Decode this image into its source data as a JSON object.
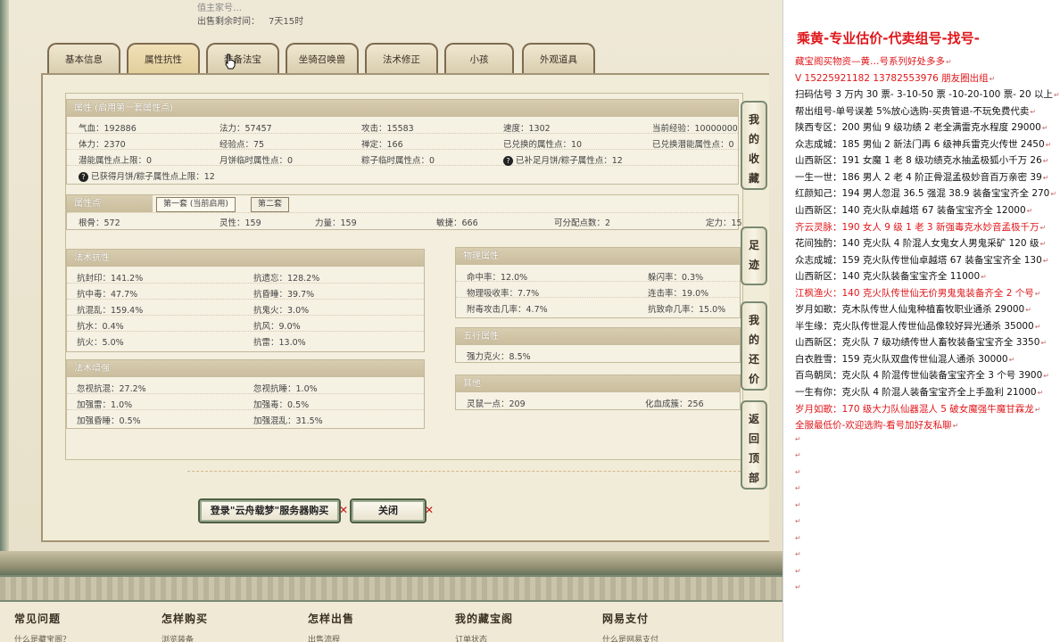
{
  "game": {
    "hidden_label": "值主家号…",
    "time_label": "出售剩余时间：",
    "time_value": "7天15时",
    "tabs": [
      "基本信息",
      "属性抗性",
      "装备法宝",
      "坐骑召唤兽",
      "法术修正",
      "小孩",
      "外观道具"
    ],
    "attributes": {
      "header": "属性 (启用第一套属性点)",
      "row1": [
        "气血：192886",
        "法力：57457",
        "攻击：15583",
        "速度：1302",
        "当前经验：10000000"
      ],
      "row2": [
        "体力：2370",
        "经验点：75",
        "禅定：166",
        "已兑换的属性点：10",
        "已兑换潜能属性点：0"
      ],
      "row3": [
        "潜能属性点上限：0",
        "月饼临时属性点：0",
        "粽子临时属性点：0",
        "已补足月饼/粽子属性点：12"
      ],
      "row4": "已获得月饼/粽子属性点上限：12"
    },
    "points": {
      "header": "属性点",
      "subtabs": [
        "第一套 (当前启用)",
        "第二套"
      ],
      "values": [
        "根骨：572",
        "灵性：159",
        "力量：159",
        "敏捷：666",
        "可分配点数：2",
        "定力：15"
      ]
    },
    "magic_resist": {
      "header": "法术抗性",
      "rows": [
        [
          "抗封印：141.2%",
          "抗遗忘：128.2%"
        ],
        [
          "抗中毒：47.7%",
          "抗昏睡：39.7%"
        ],
        [
          "抗混乱：159.4%",
          "抗鬼火：3.0%"
        ],
        [
          "抗水：0.4%",
          "抗风：9.0%"
        ],
        [
          "抗火：5.0%",
          "抗雷：13.0%"
        ]
      ]
    },
    "magic_boost": {
      "header": "法术增强",
      "rows": [
        [
          "忽视抗混：27.2%",
          "忽视抗睡：1.0%"
        ],
        [
          "加强雷：1.0%",
          "加强毒：0.5%"
        ],
        [
          "加强昏睡：0.5%",
          "加强混乱：31.5%"
        ]
      ]
    },
    "physical": {
      "header": "物理属性",
      "rows": [
        [
          "命中率：12.0%",
          "躲闪率：0.3%"
        ],
        [
          "物理吸收率：7.7%",
          "连击率：19.0%"
        ],
        [
          "附毒攻击几率：4.7%",
          "抗致命几率：15.0%"
        ]
      ]
    },
    "five_elements": {
      "header": "五行属性",
      "value": "强力克火：8.5%"
    },
    "other": {
      "header": "其他",
      "values": [
        "灵鼠一点：209",
        "化血成簇：256"
      ]
    },
    "side_buttons": [
      [
        "我",
        "的",
        "收",
        "藏"
      ],
      [
        "足",
        "迹"
      ],
      [
        "我",
        "的",
        "还",
        "价"
      ],
      [
        "返",
        "回",
        "顶",
        "部"
      ]
    ],
    "buy_button": "登录\"云舟载梦\"服务器购买",
    "close_button": "关闭",
    "footer": [
      {
        "title": "常见问题",
        "link": "什么是藏宝阁？"
      },
      {
        "title": "怎样购买",
        "link": "浏览装备"
      },
      {
        "title": "怎样出售",
        "link": "出售流程"
      },
      {
        "title": "我的藏宝阁",
        "link": "订单状态"
      },
      {
        "title": "网易支付",
        "link": "什么是网易支付"
      }
    ]
  },
  "doc": {
    "title": "乘黄-专业估价-代卖组号-找号-",
    "lines": [
      {
        "text": "藏宝阁买物资—黄…号系列好处多多",
        "color": "red"
      },
      {
        "text": "V 15225921182   13782553976 朋友圈出组",
        "color": "red"
      },
      {
        "text": "扫码估号 3 万内 30 票- 3-10-50 票  -10-20-100 票- 20 以上",
        "color": "black"
      },
      {
        "text": "帮出组号-单号误差 5%放心选购-买贵管退-不玩免费代卖",
        "color": "black"
      },
      {
        "text": "陕西专区：200 男仙 9 级功绩 2 老全满雷克水程度 29000",
        "color": "black"
      },
      {
        "text": "众志成城：185 男仙 2 新法门再 6 级神兵雷克火传世 2450",
        "color": "black"
      },
      {
        "text": "山西新区：191 女魔 1 老 8 级功绩克水抽孟极狐小千万 26",
        "color": "black"
      },
      {
        "text": "一生一世：186 男人 2 老 4 阶正骨混孟极妙音百万亲密 39",
        "color": "black"
      },
      {
        "text": "红颜知己：194 男人忽混 36.5 强混 38.9 装备宝宝齐全 270",
        "color": "black"
      },
      {
        "text": "山西新区：140 克火队卓越塔 67 装备宝宝齐全 12000",
        "color": "black"
      },
      {
        "text": "齐云灵脉：190 女人 9 级 1 老 3 新强毒克水妙音孟极千万",
        "color": "red"
      },
      {
        "text": "花间独酌：140 克火队 4 阶混人女鬼女人男鬼采矿 120 级",
        "color": "black"
      },
      {
        "text": "众志成城：159 克火队传世仙卓越塔 67 装备宝宝齐全 130",
        "color": "black"
      },
      {
        "text": "山西新区：140 克火队装备宝宝齐全 11000",
        "color": "black"
      },
      {
        "text": "江枫渔火：140 克火队传世仙无价男鬼鬼装备齐全 2 个号",
        "color": "red"
      },
      {
        "text": "岁月如歌：克木队传世人仙鬼种植畜牧职业通杀 29000",
        "color": "black"
      },
      {
        "text": "半生缘：克火队传世混人传世仙品像较好异光通杀 35000",
        "color": "black"
      },
      {
        "text": "山西新区：克火队 7 级功绩传世人畜牧装备宝宝齐全 3350",
        "color": "black"
      },
      {
        "text": "白衣胜雪：159 克火队双盘传世仙混人通杀 30000",
        "color": "black"
      },
      {
        "text": "百鸟朝凤：克火队 4 阶混传世仙装备宝宝齐全 3 个号 3900",
        "color": "black"
      },
      {
        "text": "一生有你：克火队 4 阶混人装备宝宝齐全上手盈利 21000",
        "color": "black"
      },
      {
        "text": "岁月如歌：170 级大力队仙器混人 5 破女魔强牛魔甘霖龙",
        "color": "red"
      },
      {
        "text": "全服最低价-欢迎选购-看号加好友私聊",
        "color": "red"
      }
    ]
  }
}
